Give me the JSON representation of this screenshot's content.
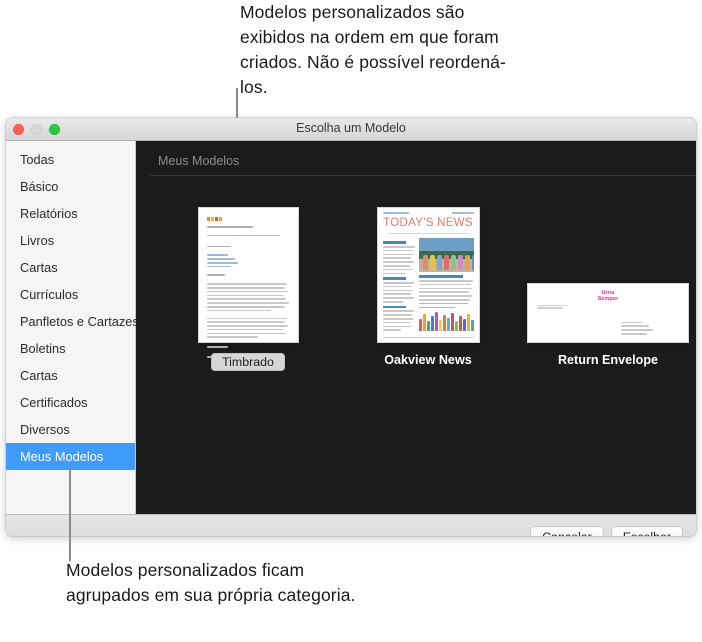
{
  "callouts": {
    "top": "Modelos personalizados são exibidos na ordem em que foram criados. Não é possível reordená-los.",
    "bottom": "Modelos personalizados ficam agrupados em sua própria categoria."
  },
  "window": {
    "title": "Escolha um Modelo",
    "traffic_lights": [
      "close-button",
      "minimize-button",
      "zoom-button"
    ]
  },
  "sidebar": {
    "items": [
      {
        "label": "Todas",
        "selected": false
      },
      {
        "label": "Básico",
        "selected": false
      },
      {
        "label": "Relatórios",
        "selected": false
      },
      {
        "label": "Livros",
        "selected": false
      },
      {
        "label": "Cartas",
        "selected": false
      },
      {
        "label": "Currículos",
        "selected": false
      },
      {
        "label": "Panfletos e Cartazes",
        "selected": false
      },
      {
        "label": "Boletins",
        "selected": false
      },
      {
        "label": "Cartas",
        "selected": false
      },
      {
        "label": "Certificados",
        "selected": false
      },
      {
        "label": "Diversos",
        "selected": false
      },
      {
        "label": "Meus Modelos",
        "selected": true
      }
    ]
  },
  "main": {
    "section_label": "Meus Modelos",
    "templates": [
      {
        "name": "Timbrado",
        "kind": "letterhead",
        "editing": true
      },
      {
        "name": "Oakview News",
        "kind": "newsletter",
        "editing": false
      },
      {
        "name": "Return Envelope",
        "kind": "envelope",
        "editing": false
      }
    ],
    "newsletter": {
      "masthead": "TODAY'S NEWS"
    },
    "envelope": {
      "logo_line1": "Urna",
      "logo_line2": "Semper"
    }
  },
  "footer": {
    "cancel_label": "Cancelar",
    "choose_label": "Escolher"
  },
  "colors": {
    "selection": "#3f9bfc",
    "panel_background": "#1b1b1b",
    "masthead": "#e8786a",
    "envelope_logo": "#ef2d8a"
  }
}
